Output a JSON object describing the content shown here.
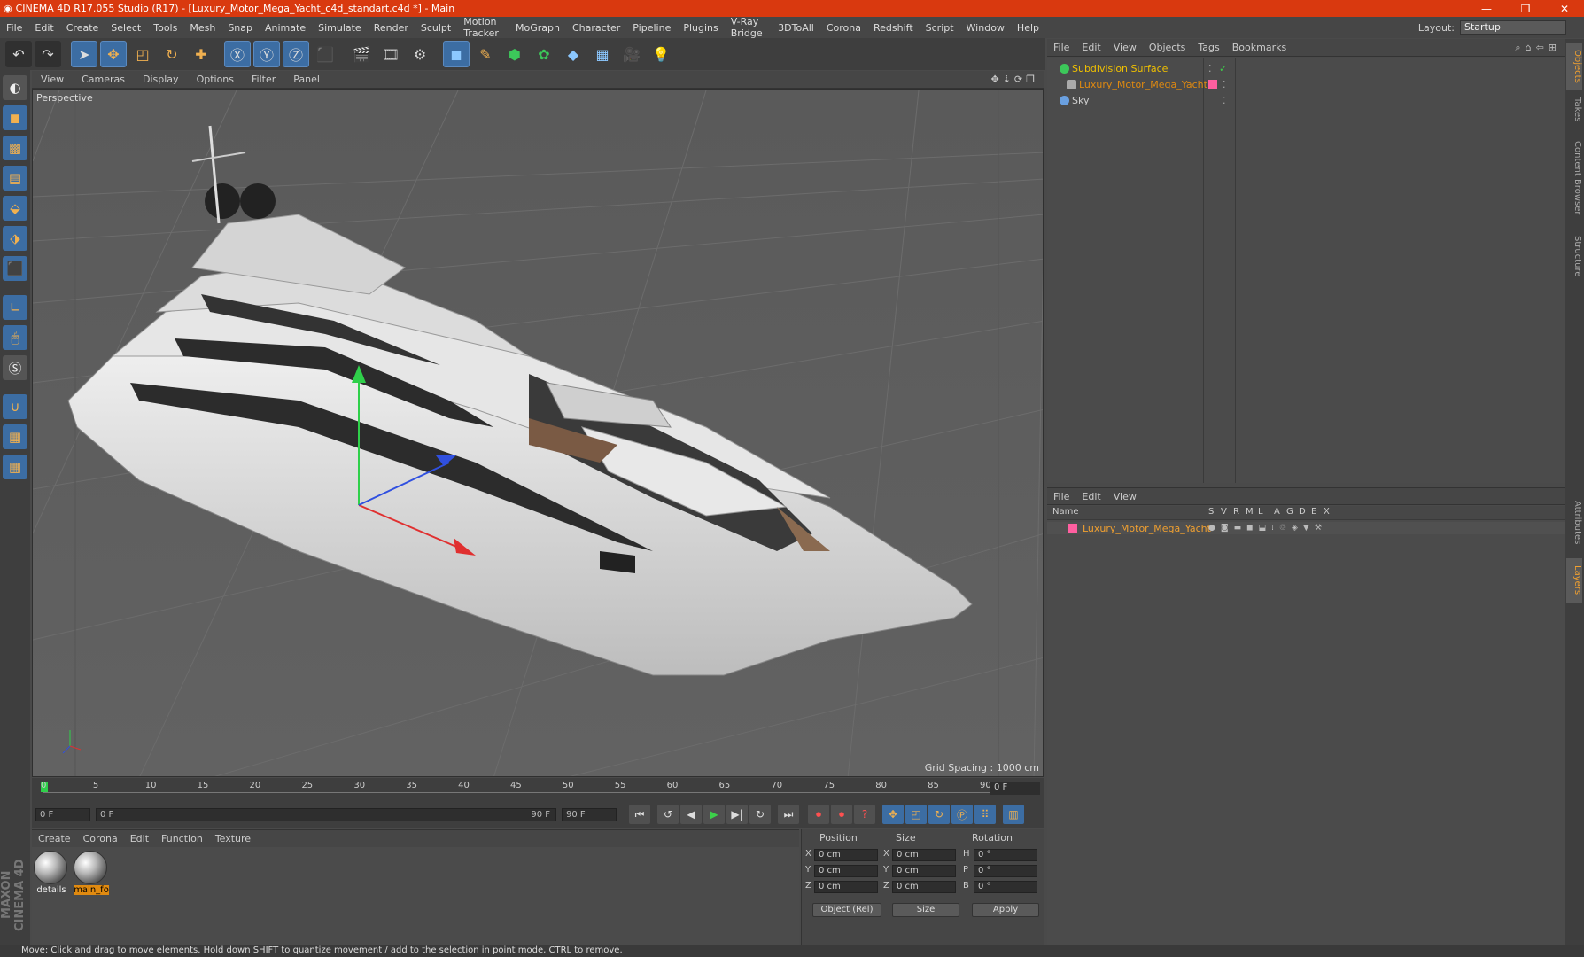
{
  "window": {
    "title": "CINEMA 4D R17.055 Studio (R17) - [Luxury_Motor_Mega_Yacht_c4d_standart.c4d *] - Main",
    "controls": [
      "—",
      "❐",
      "✕"
    ]
  },
  "menubar": [
    "File",
    "Edit",
    "Create",
    "Select",
    "Tools",
    "Mesh",
    "Snap",
    "Animate",
    "Simulate",
    "Render",
    "Sculpt",
    "Motion Tracker",
    "MoGraph",
    "Character",
    "Pipeline",
    "Plugins",
    "V-Ray Bridge",
    "3DToAll",
    "Corona",
    "Redshift",
    "Script",
    "Window",
    "Help"
  ],
  "layout": {
    "label": "Layout:",
    "value": "Startup"
  },
  "viewport": {
    "menu": [
      "View",
      "Cameras",
      "Display",
      "Options",
      "Filter",
      "Panel"
    ],
    "label": "Perspective",
    "grid_spacing": "Grid Spacing : 1000 cm"
  },
  "timeline": {
    "ticks": [
      "0",
      "5",
      "10",
      "15",
      "20",
      "25",
      "30",
      "35",
      "40",
      "45",
      "50",
      "55",
      "60",
      "65",
      "70",
      "75",
      "80",
      "85",
      "90"
    ],
    "current_frame": "0 F"
  },
  "transport": {
    "start_field": "0 F",
    "range_start": "0 F",
    "range_end": "90 F",
    "end_field": "90 F"
  },
  "materials": {
    "menu": [
      "Create",
      "Corona",
      "Edit",
      "Function",
      "Texture"
    ],
    "items": [
      {
        "name": "details",
        "selected": false
      },
      {
        "name": "main_fo",
        "selected": true
      }
    ]
  },
  "coordinates": {
    "headers": [
      "Position",
      "Size",
      "Rotation"
    ],
    "rows": [
      {
        "axis": "X",
        "pos": "0 cm",
        "size_axis": "X",
        "size": "0 cm",
        "rot_axis": "H",
        "rot": "0 °"
      },
      {
        "axis": "Y",
        "pos": "0 cm",
        "size_axis": "Y",
        "size": "0 cm",
        "rot_axis": "P",
        "rot": "0 °"
      },
      {
        "axis": "Z",
        "pos": "0 cm",
        "size_axis": "Z",
        "size": "0 cm",
        "rot_axis": "B",
        "rot": "0 °"
      }
    ],
    "mode": "Object (Rel)",
    "size_mode": "Size",
    "apply": "Apply"
  },
  "objects": {
    "menu": [
      "File",
      "Edit",
      "View",
      "Objects",
      "Tags",
      "Bookmarks"
    ],
    "items": [
      {
        "name": "Subdivision Surface",
        "color": "#f0c000",
        "icon_color": "#3cc85a"
      },
      {
        "name": "Luxury_Motor_Mega_Yacht",
        "color": "#e08a10",
        "icon_color": "#aaaaaa"
      },
      {
        "name": "Sky",
        "color": "#d0d0d0",
        "icon_color": "#6aa0e0"
      }
    ]
  },
  "layers": {
    "menu": [
      "File",
      "Edit",
      "View"
    ],
    "headers": [
      "Name",
      "S",
      "V",
      "R",
      "M",
      "L",
      "A",
      "G",
      "D",
      "E",
      "X"
    ],
    "items": [
      {
        "name": "Luxury_Motor_Mega_Yacht",
        "color": "#ff5fa0"
      }
    ]
  },
  "right_tabs": [
    "Objects",
    "Takes",
    "Content Browser",
    "Structure",
    "Attributes",
    "Layers"
  ],
  "branding": "MAXON CINEMA 4D",
  "status": "Move: Click and drag to move elements. Hold down SHIFT to quantize movement / add to the selection in point mode, CTRL to remove."
}
